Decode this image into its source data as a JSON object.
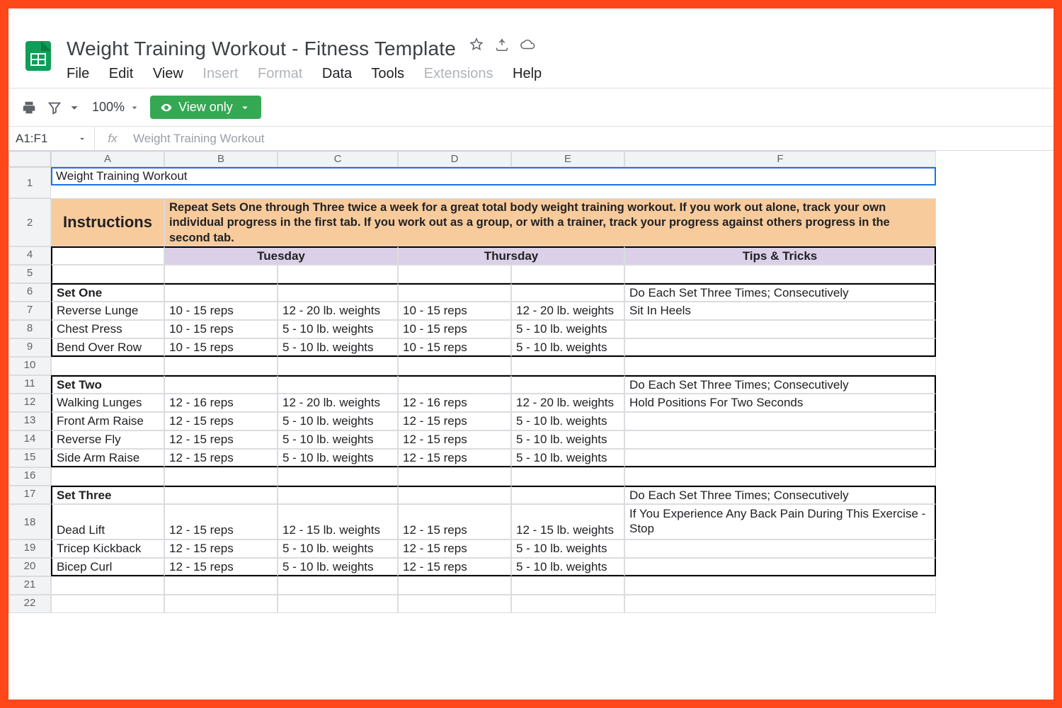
{
  "doc": {
    "title": "Weight Training Workout - Fitness Template"
  },
  "menus": {
    "file": "File",
    "edit": "Edit",
    "view": "View",
    "insert": "Insert",
    "format": "Format",
    "data": "Data",
    "tools": "Tools",
    "extensions": "Extensions",
    "help": "Help"
  },
  "toolbar": {
    "zoom": "100%",
    "view_only": "View only"
  },
  "fx": {
    "ref": "A1:F1",
    "value": "Weight Training Workout"
  },
  "cols": [
    "A",
    "B",
    "C",
    "D",
    "E",
    "F"
  ],
  "rows": {
    "title": "Weight Training Workout",
    "instructions_label": "Instructions",
    "instructions_text": "Repeat Sets One through Three twice a week for a great total body weight training workout.  If you work out alone, track your own individual progress in the first tab.  If you work out as a group, or with a trainer, track your progress against others progress in the second tab.",
    "day_tue": "Tuesday",
    "day_thu": "Thursday",
    "tips_hdr": "Tips & Tricks",
    "set1": {
      "name": "Set One",
      "tip": "Do Each Set Three Times; Consecutively",
      "ex": [
        {
          "n": "Reverse Lunge",
          "tr": "10 - 15 reps",
          "tw": "12 - 20 lb. weights",
          "hr": "10 - 15 reps",
          "hw": "12 - 20 lb. weights",
          "t": "Sit In Heels"
        },
        {
          "n": "Chest Press",
          "tr": "10 - 15 reps",
          "tw": "5 - 10 lb. weights",
          "hr": "10 - 15 reps",
          "hw": "5 - 10 lb. weights",
          "t": ""
        },
        {
          "n": "Bend Over Row",
          "tr": "10 - 15 reps",
          "tw": "5 - 10 lb. weights",
          "hr": "10 - 15 reps",
          "hw": "5 - 10 lb. weights",
          "t": ""
        }
      ]
    },
    "set2": {
      "name": "Set Two",
      "tip": "Do Each Set Three Times; Consecutively",
      "ex": [
        {
          "n": "Walking Lunges",
          "tr": "12 - 16 reps",
          "tw": "12 - 20 lb. weights",
          "hr": "12 - 16 reps",
          "hw": "12 - 20 lb. weights",
          "t": "Hold Positions For Two Seconds"
        },
        {
          "n": "Front Arm Raise",
          "tr": "12 - 15 reps",
          "tw": "5 - 10 lb. weights",
          "hr": "12 - 15 reps",
          "hw": "5 - 10 lb. weights",
          "t": ""
        },
        {
          "n": "Reverse Fly",
          "tr": "12 - 15 reps",
          "tw": "5 - 10 lb. weights",
          "hr": "12 - 15 reps",
          "hw": "5 - 10 lb. weights",
          "t": ""
        },
        {
          "n": "Side Arm Raise",
          "tr": "12 - 15 reps",
          "tw": "5 - 10 lb. weights",
          "hr": "12 - 15 reps",
          "hw": "5 - 10 lb. weights",
          "t": ""
        }
      ]
    },
    "set3": {
      "name": "Set Three",
      "tip": "Do Each Set Three Times; Consecutively",
      "ex": [
        {
          "n": "Dead Lift",
          "tr": "12 - 15 reps",
          "tw": "12 - 15 lb. weights",
          "hr": "12 - 15 reps",
          "hw": "12 - 15 lb. weights",
          "t": "If You Experience Any Back Pain During This Exercise - Stop"
        },
        {
          "n": "Tricep Kickback",
          "tr": "12 - 15 reps",
          "tw": "5 - 10 lb. weights",
          "hr": "12 - 15 reps",
          "hw": "5 - 10 lb. weights",
          "t": ""
        },
        {
          "n": "Bicep Curl",
          "tr": "12 - 15 reps",
          "tw": "5 - 10 lb. weights",
          "hr": "12 - 15 reps",
          "hw": "5 - 10 lb. weights",
          "t": ""
        }
      ]
    }
  }
}
